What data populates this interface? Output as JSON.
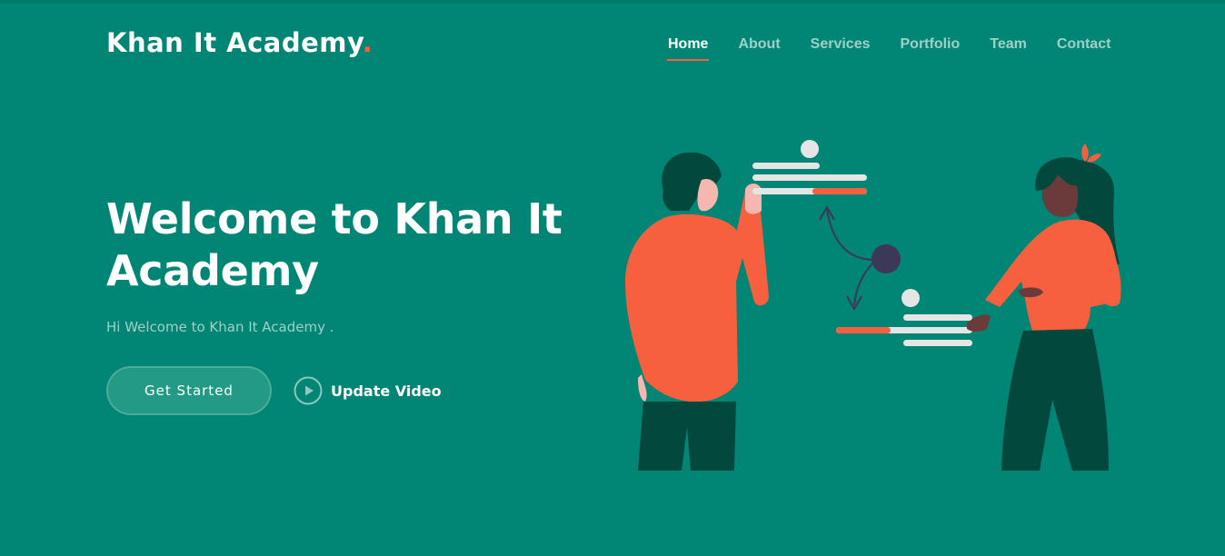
{
  "header": {
    "logo_text": "Khan It Academy",
    "logo_dot": "."
  },
  "nav": {
    "items": [
      {
        "label": "Home",
        "active": true
      },
      {
        "label": "About"
      },
      {
        "label": "Services"
      },
      {
        "label": "Portfolio"
      },
      {
        "label": "Team"
      },
      {
        "label": "Contact"
      }
    ]
  },
  "hero": {
    "title": "Welcome to Khan It Academy",
    "subtitle": "Hi Welcome to Khan It Academy .",
    "cta_label": "Get Started",
    "video_label": "Update Video"
  },
  "icons": {
    "play": "play-circle-icon"
  },
  "colors": {
    "background": "#018574",
    "accent": "#f7603f",
    "dark_green": "#03483d",
    "white": "#ffffff"
  }
}
